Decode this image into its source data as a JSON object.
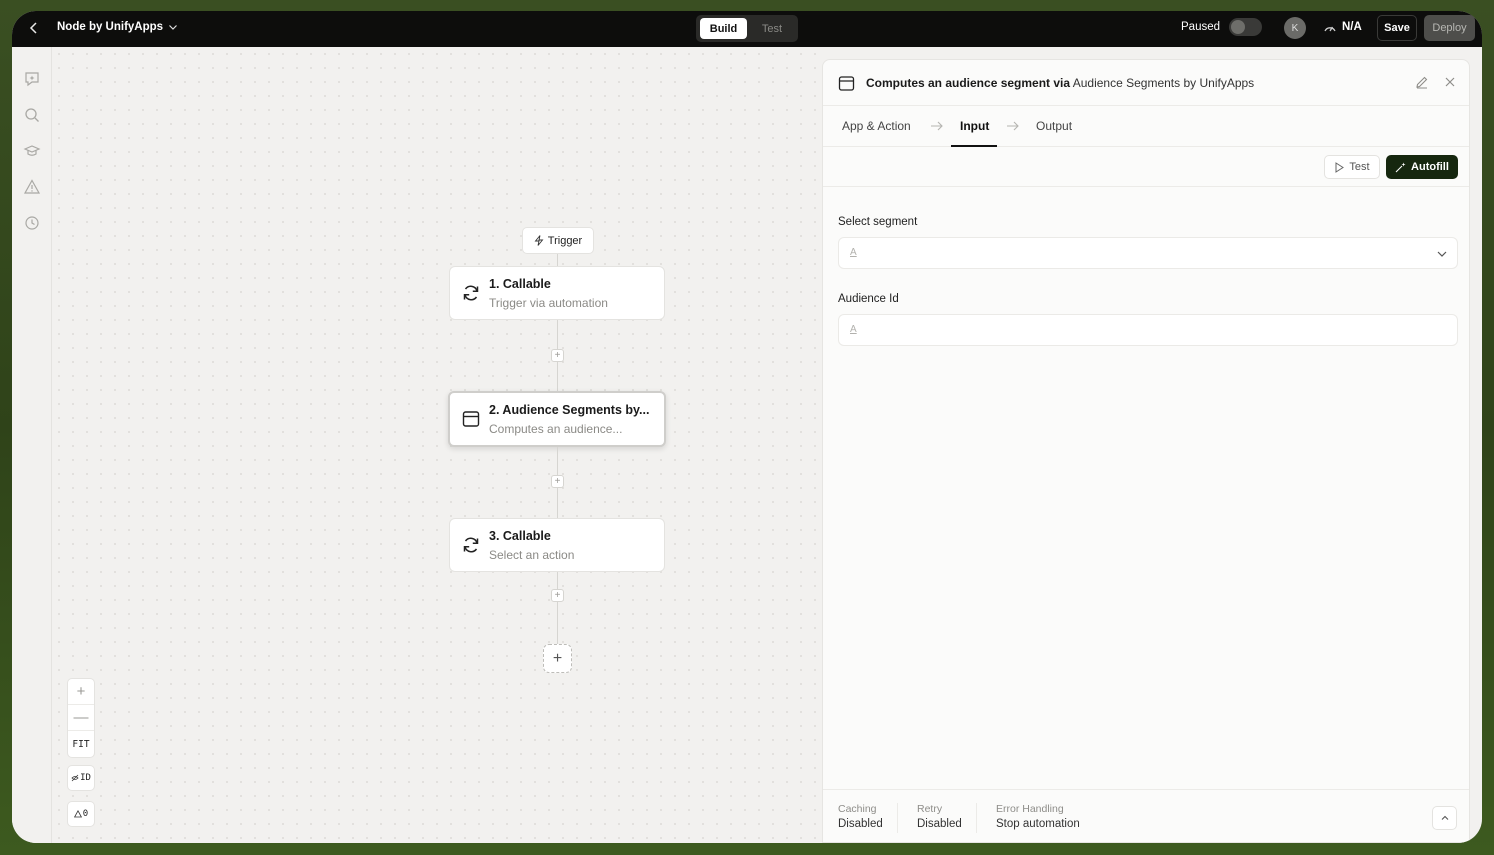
{
  "topbar": {
    "app_title": "Node by UnifyApps",
    "modes": [
      "Build",
      "Test"
    ],
    "active_mode": "Build",
    "status_label": "Paused",
    "status_on": false,
    "avatar_initial": "K",
    "usage": "N/A",
    "save_label": "Save",
    "deploy_label": "Deploy"
  },
  "rail": {
    "icons": [
      "assistant-icon",
      "search-icon",
      "learn-icon",
      "alert-icon",
      "history-icon"
    ]
  },
  "canvas": {
    "trigger_label": "Trigger",
    "nodes": [
      {
        "title": "1. Callable",
        "subtitle": "Trigger via automation",
        "icon": "refresh-icon"
      },
      {
        "title": "2. Audience Segments by...",
        "subtitle": "Computes an audience...",
        "icon": "app-window-icon"
      },
      {
        "title": "3. Callable",
        "subtitle": "Select an action",
        "icon": "refresh-icon"
      }
    ],
    "zoom_in": "+",
    "zoom_out": "—",
    "fit_label": "FIT",
    "id_label": "ID",
    "warnings_count": "0"
  },
  "panel": {
    "title_action": "Computes an audience segment via",
    "title_app": "Audience Segments by UnifyApps",
    "tabs": [
      "App & Action",
      "Input",
      "Output"
    ],
    "active_tab": "Input",
    "test_label": "Test",
    "autofill_label": "Autofill",
    "fields": [
      {
        "label": "Select segment",
        "type_glyph": "A",
        "has_dropdown": true
      },
      {
        "label": "Audience Id",
        "type_glyph": "A",
        "has_dropdown": false
      }
    ],
    "footer": [
      {
        "label": "Caching",
        "value": "Disabled"
      },
      {
        "label": "Retry",
        "value": "Disabled"
      },
      {
        "label": "Error Handling",
        "value": "Stop automation"
      }
    ]
  },
  "colors": {
    "topbar_bg": "#0d0d0c",
    "autofill_bg": "#16270f",
    "canvas_bg": "#f2f1ef",
    "outer_bg": "#3a4f22"
  }
}
